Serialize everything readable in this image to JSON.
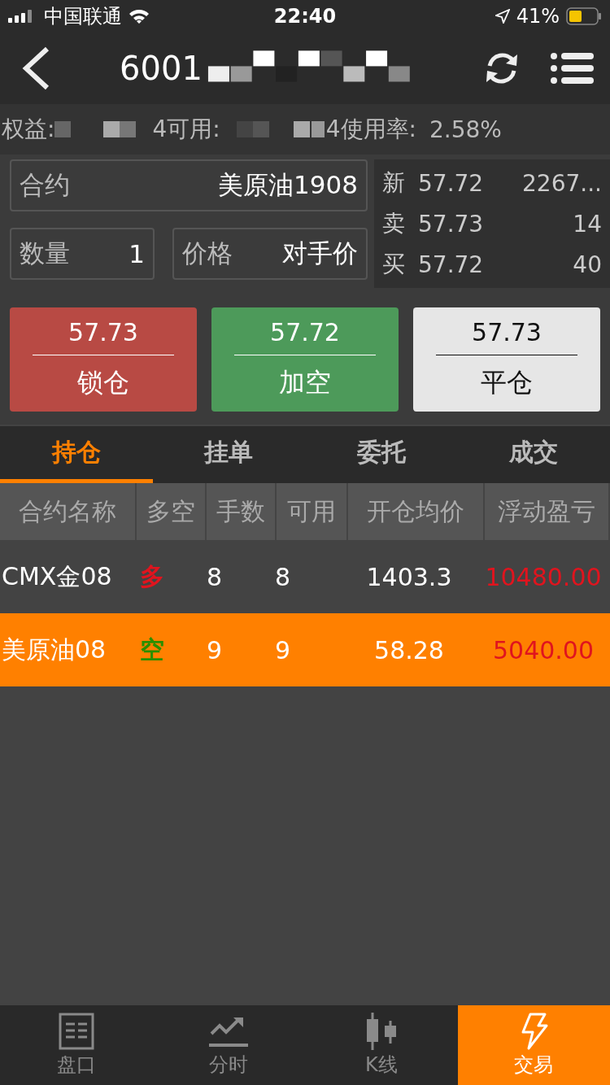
{
  "status_bar": {
    "carrier": "中国联通",
    "time": "22:40",
    "battery": "41%"
  },
  "nav": {
    "title": "6001"
  },
  "account": [
    {
      "label": "权益:"
    },
    {
      "label": "4可用:"
    },
    {
      "label": "4使用率:",
      "value": "2.58%"
    }
  ],
  "order": {
    "contract": {
      "label": "合约",
      "value": "美原油1908"
    },
    "quantity": {
      "label": "数量",
      "value": "1"
    },
    "price": {
      "label": "价格",
      "value": "对手价"
    }
  },
  "quotes": [
    {
      "label": "新",
      "price": "57.72",
      "volume": "2267..."
    },
    {
      "label": "卖",
      "price": "57.73",
      "volume": "14"
    },
    {
      "label": "买",
      "price": "57.72",
      "volume": "40"
    }
  ],
  "actions": [
    {
      "kind": "lock",
      "price": "57.73",
      "label": "锁仓"
    },
    {
      "kind": "short",
      "price": "57.72",
      "label": "加空"
    },
    {
      "kind": "close",
      "price": "57.73",
      "label": "平仓"
    }
  ],
  "tabs": [
    {
      "label": "持仓",
      "selected": true
    },
    {
      "label": "挂单",
      "selected": false
    },
    {
      "label": "委托",
      "selected": false
    },
    {
      "label": "成交",
      "selected": false
    }
  ],
  "table": {
    "columns": [
      "合约名称",
      "多空",
      "手数",
      "可用",
      "开仓均价",
      "浮动盈亏"
    ],
    "rows": [
      {
        "selected": false,
        "cells": [
          "CMX金08",
          "多",
          "8",
          "8",
          "1403.3",
          "10480.00"
        ],
        "color": "#e0141e"
      },
      {
        "selected": true,
        "cells": [
          "美原油08",
          "空",
          "9",
          "9",
          "58.28",
          "5040.00"
        ],
        "color": "#2a8f00"
      }
    ]
  },
  "bottom_nav": [
    {
      "kind": "book",
      "label": "盘口",
      "selected": false
    },
    {
      "kind": "trend",
      "label": "分时",
      "selected": false
    },
    {
      "kind": "candle",
      "label": "K线",
      "selected": false
    },
    {
      "kind": "bolt",
      "label": "交易",
      "selected": true
    }
  ]
}
